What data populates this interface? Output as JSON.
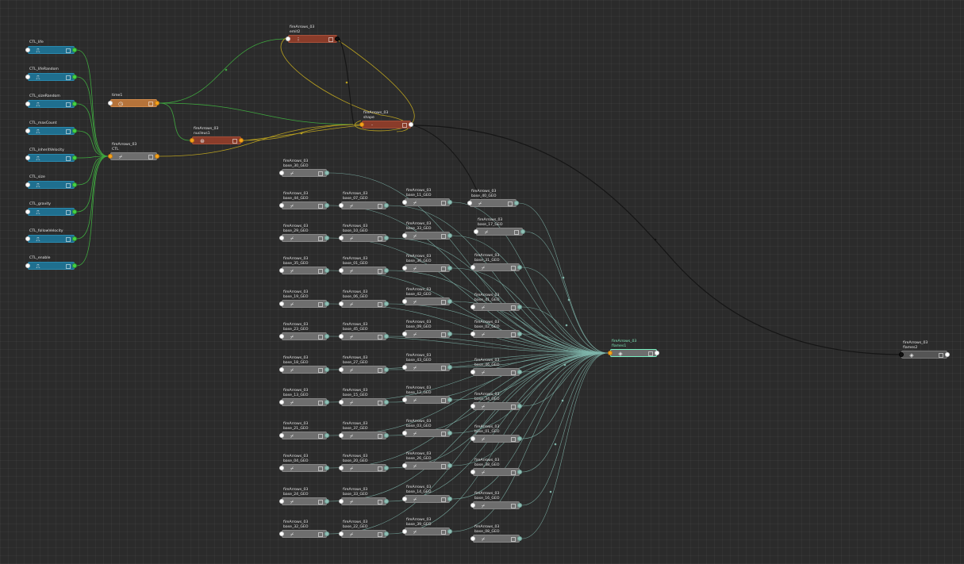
{
  "graph": {
    "ctl_nodes": [
      {
        "name": "CTL_life"
      },
      {
        "name": "CTL_lifeRandom"
      },
      {
        "name": "CTL_sizeRandom"
      },
      {
        "name": "CTL_maxCount"
      },
      {
        "name": "CTL_inheritVelocity"
      },
      {
        "name": "CTL_size"
      },
      {
        "name": "CTL_gravity"
      },
      {
        "name": "CTL_followVelocity"
      },
      {
        "name": "CTL_enable"
      }
    ],
    "time_node": {
      "name": "time1"
    },
    "ctl_main": {
      "namespace": "fireArrows_03",
      "name": "CTL"
    },
    "emit": {
      "namespace": "fireArrows_03",
      "name": "emit2"
    },
    "nucleus": {
      "namespace": "fireArrows_03",
      "name": "nucleus1"
    },
    "shape": {
      "namespace": "fireArrows_03",
      "name": "shape"
    },
    "flames1": {
      "namespace": "fireArrows_03",
      "name": "flames1"
    },
    "flames2": {
      "namespace": "fireArrows_03",
      "name": "flames2"
    },
    "geo_col1": [
      {
        "namespace": "fireArrows_03",
        "name": "base_30_GEO"
      },
      {
        "namespace": "fireArrows_03",
        "name": "base_44_GEO"
      },
      {
        "namespace": "fireArrows_03",
        "name": "base_29_GEO"
      },
      {
        "namespace": "fireArrows_03",
        "name": "base_35_GEO"
      },
      {
        "namespace": "fireArrows_03",
        "name": "base_19_GEO"
      },
      {
        "namespace": "fireArrows_03",
        "name": "base_23_GEO"
      },
      {
        "namespace": "fireArrows_03",
        "name": "base_18_GEO"
      },
      {
        "namespace": "fireArrows_03",
        "name": "base_13_GEO"
      },
      {
        "namespace": "fireArrows_03",
        "name": "base_21_GEO"
      },
      {
        "namespace": "fireArrows_03",
        "name": "base_04_GEO"
      },
      {
        "namespace": "fireArrows_03",
        "name": "base_24_GEO"
      },
      {
        "namespace": "fireArrows_03",
        "name": "base_32_GEO"
      }
    ],
    "geo_col2": [
      {
        "namespace": "fireArrows_03",
        "name": "base_07_GEO"
      },
      {
        "namespace": "fireArrows_03",
        "name": "base_10_GEO"
      },
      {
        "namespace": "fireArrows_03",
        "name": "base_01_GEO"
      },
      {
        "namespace": "fireArrows_03",
        "name": "base_06_GEO"
      },
      {
        "namespace": "fireArrows_03",
        "name": "base_45_GEO"
      },
      {
        "namespace": "fireArrows_03",
        "name": "base_27_GEO"
      },
      {
        "namespace": "fireArrows_03",
        "name": "base_15_GEO"
      },
      {
        "namespace": "fireArrows_03",
        "name": "base_37_GEO"
      },
      {
        "namespace": "fireArrows_03",
        "name": "base_20_GEO"
      },
      {
        "namespace": "fireArrows_03",
        "name": "base_33_GEO"
      },
      {
        "namespace": "fireArrows_03",
        "name": "base_22_GEO"
      }
    ],
    "geo_col3": [
      {
        "namespace": "fireArrows_03",
        "name": "base_11_GEO"
      },
      {
        "namespace": "fireArrows_03",
        "name": "base_33_GEO"
      },
      {
        "namespace": "fireArrows_03",
        "name": "base_36_GEO"
      },
      {
        "namespace": "fireArrows_03",
        "name": "base_42_GEO"
      },
      {
        "namespace": "fireArrows_03",
        "name": "base_09_GEO"
      },
      {
        "namespace": "fireArrows_03",
        "name": "base_43_GEO"
      },
      {
        "namespace": "fireArrows_03",
        "name": "base_12_GEO"
      },
      {
        "namespace": "fireArrows_03",
        "name": "base_03_GEO"
      },
      {
        "namespace": "fireArrows_03",
        "name": "base_26_GEO"
      },
      {
        "namespace": "fireArrows_03",
        "name": "base_14_GEO"
      },
      {
        "namespace": "fireArrows_03",
        "name": "base_39_GEO"
      }
    ],
    "geo_col4": [
      {
        "namespace": "fireArrows_03",
        "name": "base_40_GEO"
      },
      {
        "namespace": "fireArrows_03",
        "name": "base_17_GEO"
      },
      {
        "namespace": "fireArrows_03",
        "name": "base_31_GEO"
      },
      {
        "namespace": "fireArrows_03",
        "name": "base_41_GEO"
      },
      {
        "namespace": "fireArrows_03",
        "name": "base_02_GEO"
      },
      {
        "namespace": "fireArrows_03",
        "name": "base_46_GEO"
      },
      {
        "namespace": "fireArrows_03",
        "name": "base_34_GEO"
      },
      {
        "namespace": "fireArrows_03",
        "name": "base_01_GEO"
      },
      {
        "namespace": "fireArrows_03",
        "name": "base_38_GEO"
      },
      {
        "namespace": "fireArrows_03",
        "name": "base_16_GEO"
      },
      {
        "namespace": "fireArrows_03",
        "name": "base_08_GEO"
      }
    ]
  },
  "colors": {
    "background": "#2b2b2b",
    "ctl_node": "#1f6f8f",
    "geo_node": "#6e6e6e",
    "time_node": "#b5733a",
    "dynamics_node": "#8a3c2a",
    "selected_outline": "#78f0c0",
    "wire_green": "#3fa83f",
    "wire_yellow": "#b8a020",
    "wire_teal": "#7fb5aa",
    "wire_black": "#151515",
    "port_orange": "#f5a21a",
    "port_green": "#46d246"
  }
}
